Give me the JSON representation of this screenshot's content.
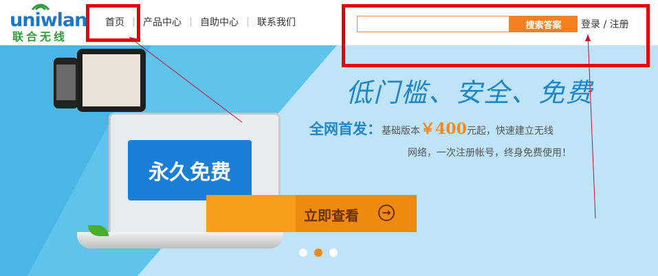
{
  "header": {
    "logo_text": "uniwlan",
    "logo_cn": "联合无线",
    "nav": [
      "首页",
      "产品中心",
      "自助中心",
      "联系我们"
    ],
    "search": {
      "value": "",
      "button": "搜索答案"
    },
    "login": "登录",
    "login_sep": " / ",
    "register": "注册"
  },
  "banner": {
    "free_label": "永久免费",
    "cta_label": "立即查看",
    "slogan": "低门槛、安全、免费",
    "desc_lead": "全网首发：",
    "desc_pre": "基础版本",
    "desc_price": "￥400",
    "desc_post": "元起，快速建立无线",
    "desc_line2": "网络，一次注册帐号，终身免费使用！",
    "slides": [
      false,
      true,
      false
    ]
  },
  "colors": {
    "highlight": "#e60000",
    "accent": "#f47f20",
    "brand_blue": "#1d77c8",
    "banner_bg": "#bfe3f7"
  }
}
